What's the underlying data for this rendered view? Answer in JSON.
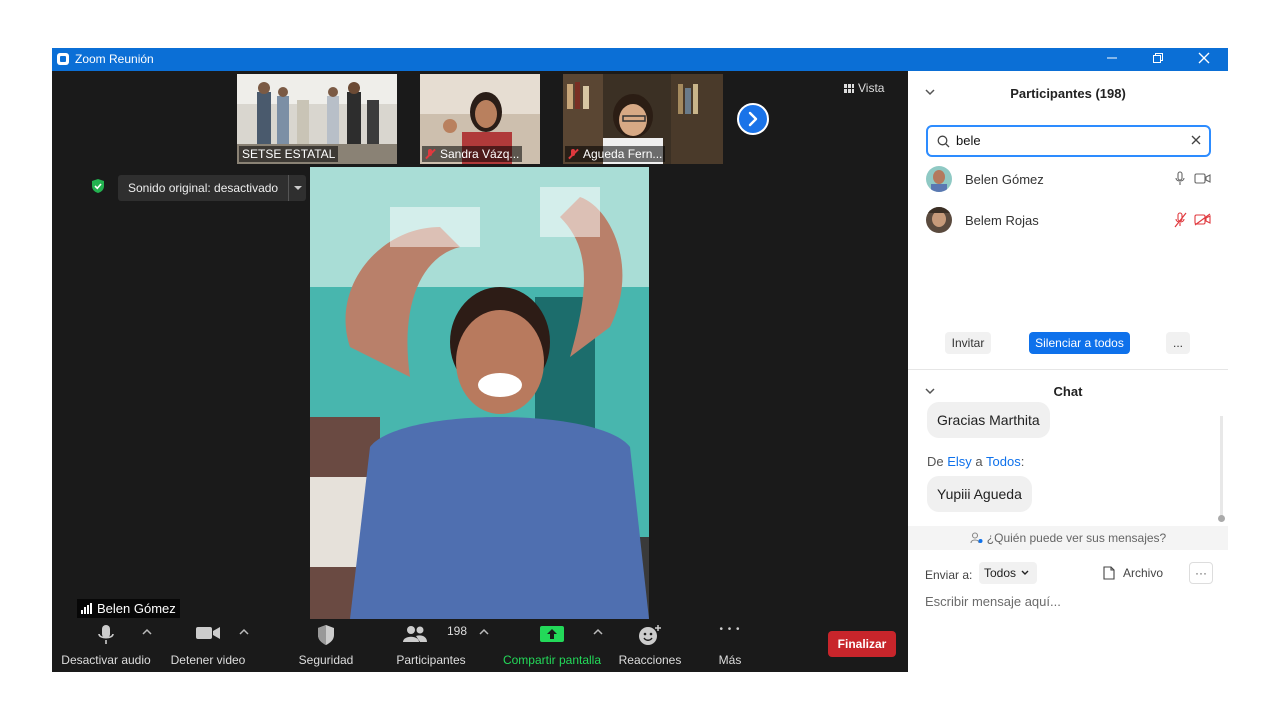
{
  "window": {
    "title": "Zoom Reunión",
    "minimize_label": "—",
    "restore_label": "❐",
    "close_label": "✕"
  },
  "thumbnails": [
    {
      "name": "SETSE ESTATAL",
      "muted": false
    },
    {
      "name": "Sandra Vázq...",
      "muted": true
    },
    {
      "name": "Agueda Fern...",
      "muted": true
    }
  ],
  "view_button": {
    "label": "Vista"
  },
  "audio_indicator": {
    "label": "Sonido original: desactivado"
  },
  "active_speaker": {
    "name": "Belen Gómez"
  },
  "toolbar": {
    "audio": "Desactivar audio",
    "video": "Detener video",
    "security": "Seguridad",
    "participants": "Participantes",
    "participants_count": "198",
    "share": "Compartir pantalla",
    "reactions": "Reacciones",
    "more": "Más",
    "end": "Finalizar",
    "more_dots": "• • •"
  },
  "participants_panel": {
    "title": "Participantes (198)",
    "search_value": "bele",
    "participants": [
      {
        "name": "Belen Gómez",
        "audio": "on",
        "video": "off"
      },
      {
        "name": "Belem Rojas",
        "audio": "muted",
        "video": "muted"
      }
    ],
    "invite": "Invitar",
    "mute_all": "Silenciar a todos",
    "more": "..."
  },
  "chat_panel": {
    "title": "Chat",
    "messages": [
      {
        "text": "Gracias Marthita"
      },
      {
        "prefix": "De ",
        "sender": "Elsy",
        "middle": " a ",
        "recipient": "Todos",
        "suffix": ":",
        "text": "Yupiii Agueda"
      }
    ],
    "who_can_see": "¿Quién puede ver sus mensajes?",
    "send_to_label": "Enviar a:",
    "send_to_value": "Todos",
    "file_label": "Archivo",
    "more": "···",
    "input_placeholder": "Escribir mensaje aquí..."
  },
  "colors": {
    "title_bar": "#0b6fd6",
    "end_button": "#c8252b",
    "share_green": "#23d959",
    "primary_blue": "#0e71eb",
    "muted_red": "#e0393e"
  }
}
